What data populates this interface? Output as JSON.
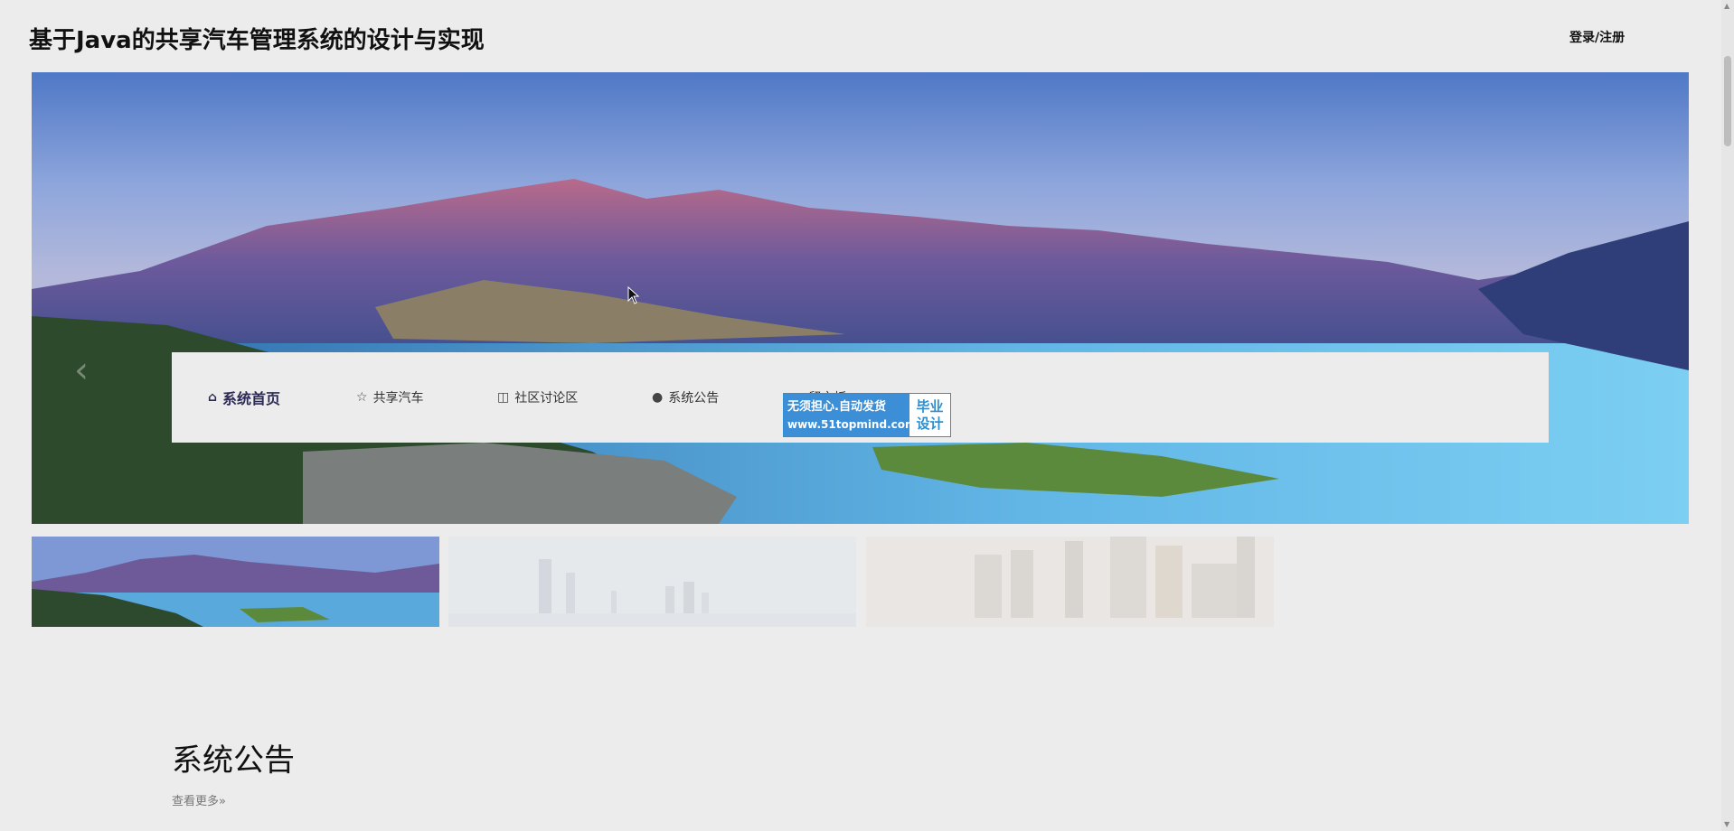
{
  "header": {
    "title": "基于Java的共享汽车管理系统的设计与实现",
    "auth_link": "登录/注册"
  },
  "nav": {
    "items": [
      {
        "label": "系统首页",
        "icon": "home-icon",
        "active": true
      },
      {
        "label": "共享汽车",
        "icon": "star-icon",
        "active": false
      },
      {
        "label": "社区讨论区",
        "icon": "bag-icon",
        "active": false
      },
      {
        "label": "系统公告",
        "icon": "alert-icon",
        "active": false
      },
      {
        "label": "留言板",
        "icon": "chat-icon",
        "active": false
      }
    ]
  },
  "stamp": {
    "line1": "无须担心.自动发货",
    "line2": "www.51topmind.com",
    "right1": "毕业",
    "right2": "设计"
  },
  "carousel": {
    "prev_icon": "chevron-left-icon",
    "next_icon": "chevron-right-icon",
    "thumbnails": [
      "lake-mountains-thumbnail",
      "city-skyline-thumbnail",
      "city-towers-thumbnail"
    ]
  },
  "notice": {
    "title": "系统公告",
    "more": "查看更多»"
  }
}
